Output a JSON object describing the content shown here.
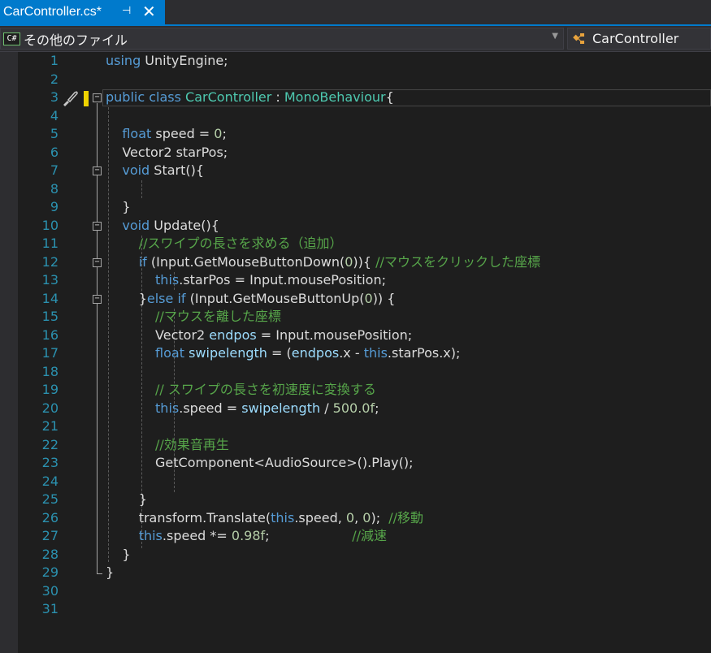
{
  "tab": {
    "title": "CarController.cs*",
    "pin_glyph": "⊣",
    "close_glyph": "✕"
  },
  "nav": {
    "cs_icon_text": "C#",
    "file_scope": "その他のファイル",
    "class_name": "CarController",
    "dropdown_glyph": "▼"
  },
  "colors": {
    "accent": "#007acc",
    "keyword": "#569cd6",
    "type": "#4ec9b0",
    "comment": "#57a64a",
    "line_number": "#2b91af",
    "text": "#dcdcdc"
  },
  "icons": {
    "cs_file": "csharp-file-icon",
    "class": "class-icon",
    "quick_action": "brush-icon"
  },
  "code": {
    "line_numbers": [
      "1",
      "2",
      "3",
      "4",
      "5",
      "6",
      "7",
      "8",
      "9",
      "10",
      "11",
      "12",
      "13",
      "14",
      "15",
      "16",
      "17",
      "18",
      "19",
      "20",
      "21",
      "22",
      "23",
      "24",
      "25",
      "26",
      "27",
      "28",
      "29",
      "30",
      "31"
    ],
    "lines": [
      "using UnityEngine;",
      "",
      "public class CarController : MonoBehaviour{",
      "",
      "    float speed = 0;",
      "    Vector2 starPos;",
      "    void Start(){",
      "",
      "    }",
      "    void Update(){",
      "        //スワイプの長さを求める（追加）",
      "        if (Input.GetMouseButtonDown(0)){ //マウスをクリックした座標",
      "            this.starPos = Input.mousePosition;",
      "        }else if (Input.GetMouseButtonUp(0)) {",
      "            //マウスを離した座標",
      "            Vector2 endpos = Input.mousePosition;",
      "            float swipelength = (endpos.x - this.starPos.x);",
      "",
      "            // スワイプの長さを初速度に変換する",
      "            this.speed = swipelength / 500.0f;",
      "",
      "            //効果音再生",
      "            GetComponent<AudioSource>().Play();",
      "",
      "        }",
      "        transform.Translate(this.speed, 0, 0);  //移動",
      "        this.speed *= 0.98f;                    //減速",
      "    }",
      "}",
      "",
      ""
    ]
  }
}
